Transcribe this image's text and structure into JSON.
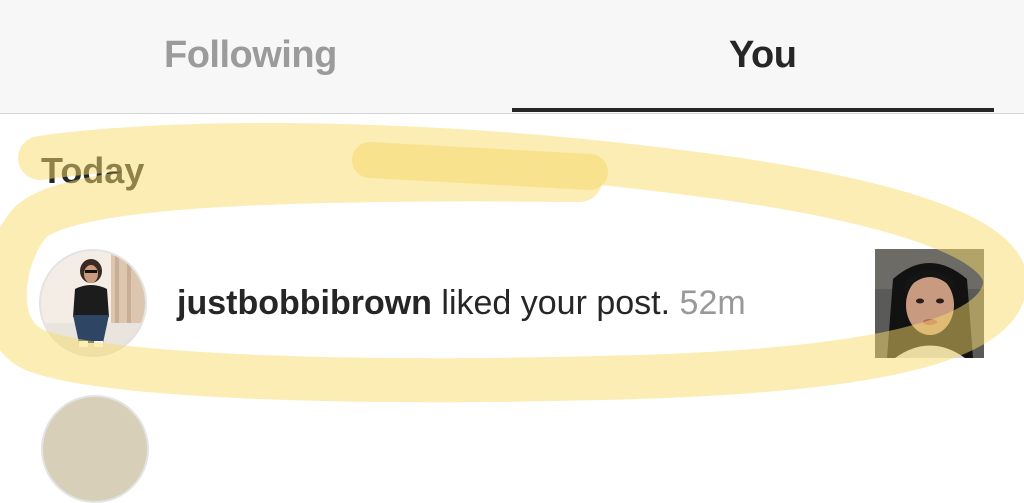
{
  "tabs": {
    "following_label": "Following",
    "you_label": "You",
    "active": "You"
  },
  "section": {
    "heading": "Today"
  },
  "notifications": [
    {
      "username": "justbobbibrown",
      "action": " liked your post.",
      "time": "52m"
    }
  ],
  "colors": {
    "highlighter": "#f8dc6a",
    "active_tab": "#262626",
    "inactive_tab": "#9b9b9b",
    "timestamp": "#999999"
  },
  "icons": {
    "avatar": "user-avatar",
    "post_thumbnail": "post-thumbnail"
  }
}
